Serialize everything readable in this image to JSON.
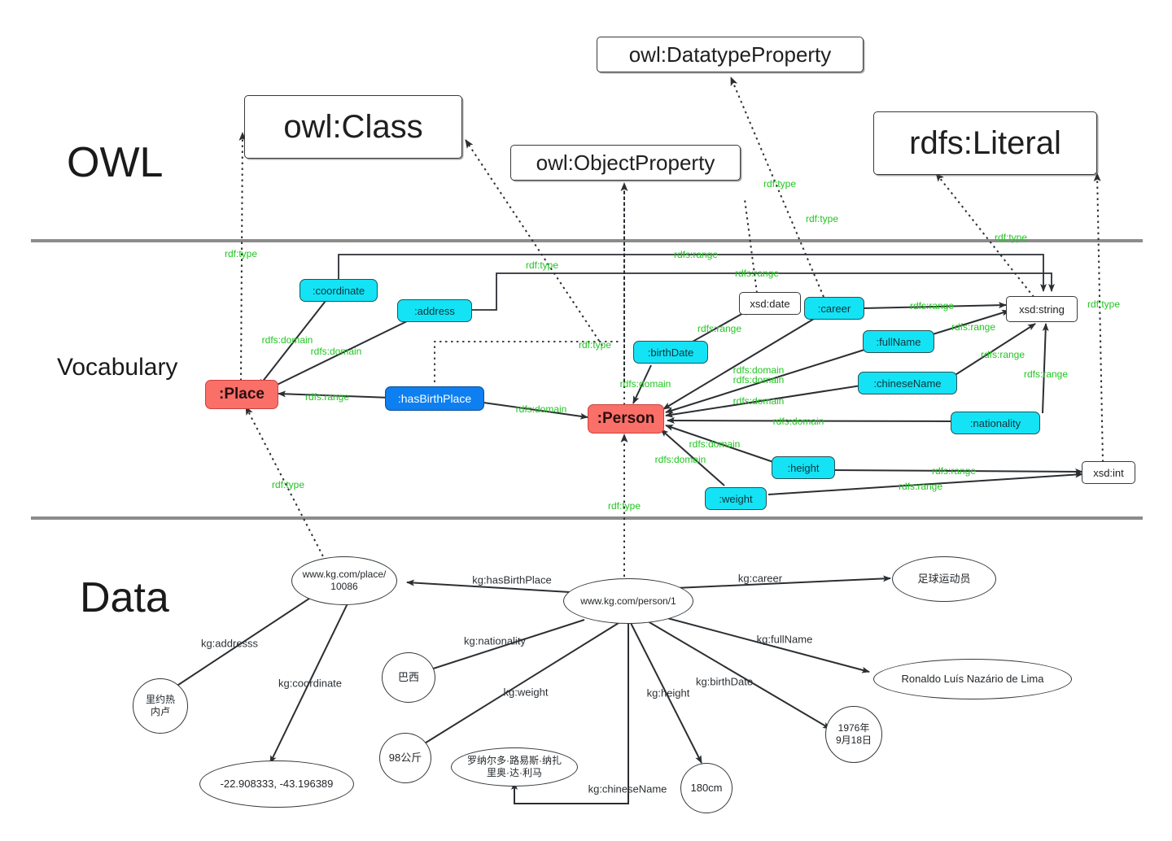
{
  "diagram": {
    "title": "RDF/OWL Knowledge Graph Layers",
    "colors": {
      "class_node": "#fa6f68",
      "object_property": "#0d7ff0",
      "datatype_property": "#13e3f5",
      "edge_label": "#21c521",
      "data_edge_label": "#2c3034",
      "divider": "#8c8c8c"
    }
  },
  "layers": [
    {
      "name": "layer-owl",
      "label": "OWL"
    },
    {
      "name": "layer-vocabulary",
      "label": "Vocabulary"
    },
    {
      "name": "layer-data",
      "label": "Data"
    }
  ],
  "owl_layer": {
    "nodes": [
      {
        "id": "owl-class",
        "label": "owl:Class"
      },
      {
        "id": "owl-datatypeproperty",
        "label": "owl:DatatypeProperty"
      },
      {
        "id": "owl-objectproperty",
        "label": "owl:ObjectProperty"
      },
      {
        "id": "rdfs-literal",
        "label": "rdfs:Literal"
      }
    ]
  },
  "vocabulary_layer": {
    "classes": [
      {
        "id": "place",
        "label": ":Place"
      },
      {
        "id": "person",
        "label": ":Person"
      }
    ],
    "object_properties": [
      {
        "id": "hasbirthplace",
        "label": ":hasBirthPlace"
      }
    ],
    "datatype_properties": [
      {
        "id": "coordinate",
        "label": ":coordinate"
      },
      {
        "id": "address",
        "label": ":address"
      },
      {
        "id": "birthdate",
        "label": ":birthDate"
      },
      {
        "id": "career",
        "label": ":career"
      },
      {
        "id": "fullname",
        "label": ":fullName"
      },
      {
        "id": "chinesename",
        "label": ":chineseName"
      },
      {
        "id": "nationality",
        "label": ":nationality"
      },
      {
        "id": "height",
        "label": ":height"
      },
      {
        "id": "weight",
        "label": ":weight"
      }
    ],
    "datatypes": [
      {
        "id": "xsd-date",
        "label": "xsd:date"
      },
      {
        "id": "xsd-string",
        "label": "xsd:string"
      },
      {
        "id": "xsd-int",
        "label": "xsd:int"
      }
    ]
  },
  "data_layer": {
    "nodes": [
      {
        "id": "place-uri",
        "label": "www.kg.com/place/\n10086"
      },
      {
        "id": "person-uri",
        "label": "www.kg.com/person/1"
      },
      {
        "id": "address-value",
        "label": "里约热\n内卢"
      },
      {
        "id": "coordinate-value",
        "label": "-22.908333, -43.196389"
      },
      {
        "id": "nationality-value",
        "label": "巴西"
      },
      {
        "id": "weight-value",
        "label": "98公斤"
      },
      {
        "id": "chinesename-value",
        "label": "罗纳尔多·路易斯·纳扎\n里奥·达·利马"
      },
      {
        "id": "height-value",
        "label": "180cm"
      },
      {
        "id": "birthdate-value",
        "label": "1976年\n9月18日"
      },
      {
        "id": "career-value",
        "label": "足球运动员"
      },
      {
        "id": "fullname-value",
        "label": "Ronaldo Luís Nazário de Lima"
      }
    ]
  },
  "edge_labels": {
    "rdf_type": "rdf:type",
    "rdfs_domain": "rdfs:domain",
    "rdfs_range": "rdfs:range",
    "kg_hasbirthplace": "kg:hasBirthPlace",
    "kg_career": "kg:career",
    "kg_addresss": "kg:addresss",
    "kg_coordinate": "kg:coordinate",
    "kg_nationality": "kg:nationality",
    "kg_weight": "kg:weight",
    "kg_fullname": "kg:fullName",
    "kg_birthdate": "kg:birthDate",
    "kg_height": "kg:height",
    "kg_chinesename": "kg:chineseName"
  },
  "edges": [
    {
      "name": "edge-place-rdftype-owlclass",
      "label_key": "rdf_type",
      "style": "dotted"
    },
    {
      "name": "edge-hasbirthplace-rdftype-owlobjectproperty",
      "label_key": "rdf_type",
      "style": "dotted"
    },
    {
      "name": "edge-address-rdftype-owldatatypeproperty",
      "label_key": "rdf_type",
      "style": "dotted"
    },
    {
      "name": "edge-career-rdftype-owldatatypeproperty",
      "label_key": "rdf_type",
      "style": "dotted"
    },
    {
      "name": "edge-person-rdftype-owlclass",
      "label_key": "rdf_type",
      "style": "dotted"
    },
    {
      "name": "edge-xsdstring-rdftype-rdfsliteral",
      "label_key": "rdf_type",
      "style": "dotted"
    },
    {
      "name": "edge-xsdint-rdftype-rdfsliteral",
      "label_key": "rdf_type",
      "style": "dotted"
    },
    {
      "name": "edge-placeuri-rdftype-place",
      "label_key": "rdf_type",
      "style": "dotted"
    },
    {
      "name": "edge-personuri-rdftype-person",
      "label_key": "rdf_type",
      "style": "dotted"
    },
    {
      "name": "edge-coordinate-domain-place",
      "label_key": "rdfs_domain",
      "style": "solid"
    },
    {
      "name": "edge-address-domain-place",
      "label_key": "rdfs_domain",
      "style": "solid"
    },
    {
      "name": "edge-hasbirthplace-range-place",
      "label_key": "rdfs_range",
      "style": "solid"
    },
    {
      "name": "edge-hasbirthplace-domain-person",
      "label_key": "rdfs_domain",
      "style": "solid"
    },
    {
      "name": "edge-birthdate-domain-person",
      "label_key": "rdfs_domain",
      "style": "solid"
    },
    {
      "name": "edge-career-domain-person",
      "label_key": "rdfs_domain",
      "style": "solid"
    },
    {
      "name": "edge-fullname-domain-person",
      "label_key": "rdfs_domain",
      "style": "solid"
    },
    {
      "name": "edge-chinesename-domain-person",
      "label_key": "rdfs_domain",
      "style": "solid"
    },
    {
      "name": "edge-nationality-domain-person",
      "label_key": "rdfs_domain",
      "style": "solid"
    },
    {
      "name": "edge-height-domain-person",
      "label_key": "rdfs_domain",
      "style": "solid"
    },
    {
      "name": "edge-weight-domain-person",
      "label_key": "rdfs_domain",
      "style": "solid"
    },
    {
      "name": "edge-birthdate-range-xsddate",
      "label_key": "rdfs_range",
      "style": "solid"
    },
    {
      "name": "edge-coordinate-range-xsdstring",
      "label_key": "rdfs_range",
      "style": "solid"
    },
    {
      "name": "edge-address-range-xsdstring",
      "label_key": "rdfs_range",
      "style": "solid"
    },
    {
      "name": "edge-career-range-xsdstring",
      "label_key": "rdfs_range",
      "style": "solid"
    },
    {
      "name": "edge-fullname-range-xsdstring",
      "label_key": "rdfs_range",
      "style": "solid"
    },
    {
      "name": "edge-chinesename-range-xsdstring",
      "label_key": "rdfs_range",
      "style": "solid"
    },
    {
      "name": "edge-nationality-range-xsdstring",
      "label_key": "rdfs_range",
      "style": "solid"
    },
    {
      "name": "edge-height-range-xsdint",
      "label_key": "rdfs_range",
      "style": "solid"
    },
    {
      "name": "edge-weight-range-xsdint",
      "label_key": "rdfs_range",
      "style": "solid"
    },
    {
      "name": "edge-personuri-hasbirthplace-placeuri",
      "label_key": "kg_hasbirthplace",
      "style": "solid"
    },
    {
      "name": "edge-personuri-career-careervalue",
      "label_key": "kg_career",
      "style": "solid"
    },
    {
      "name": "edge-placeuri-addresss-addressvalue",
      "label_key": "kg_addresss",
      "style": "solid"
    },
    {
      "name": "edge-placeuri-coordinate-coordvalue",
      "label_key": "kg_coordinate",
      "style": "solid"
    },
    {
      "name": "edge-personuri-nationality-natvalue",
      "label_key": "kg_nationality",
      "style": "solid"
    },
    {
      "name": "edge-personuri-weight-weightvalue",
      "label_key": "kg_weight",
      "style": "solid"
    },
    {
      "name": "edge-personuri-fullname-fullnamevalue",
      "label_key": "kg_fullname",
      "style": "solid"
    },
    {
      "name": "edge-personuri-birthdate-birthvalue",
      "label_key": "kg_birthdate",
      "style": "solid"
    },
    {
      "name": "edge-personuri-height-heightvalue",
      "label_key": "kg_height",
      "style": "solid"
    },
    {
      "name": "edge-personuri-chinesename-cnvalue",
      "label_key": "kg_chinesename",
      "style": "solid"
    }
  ]
}
